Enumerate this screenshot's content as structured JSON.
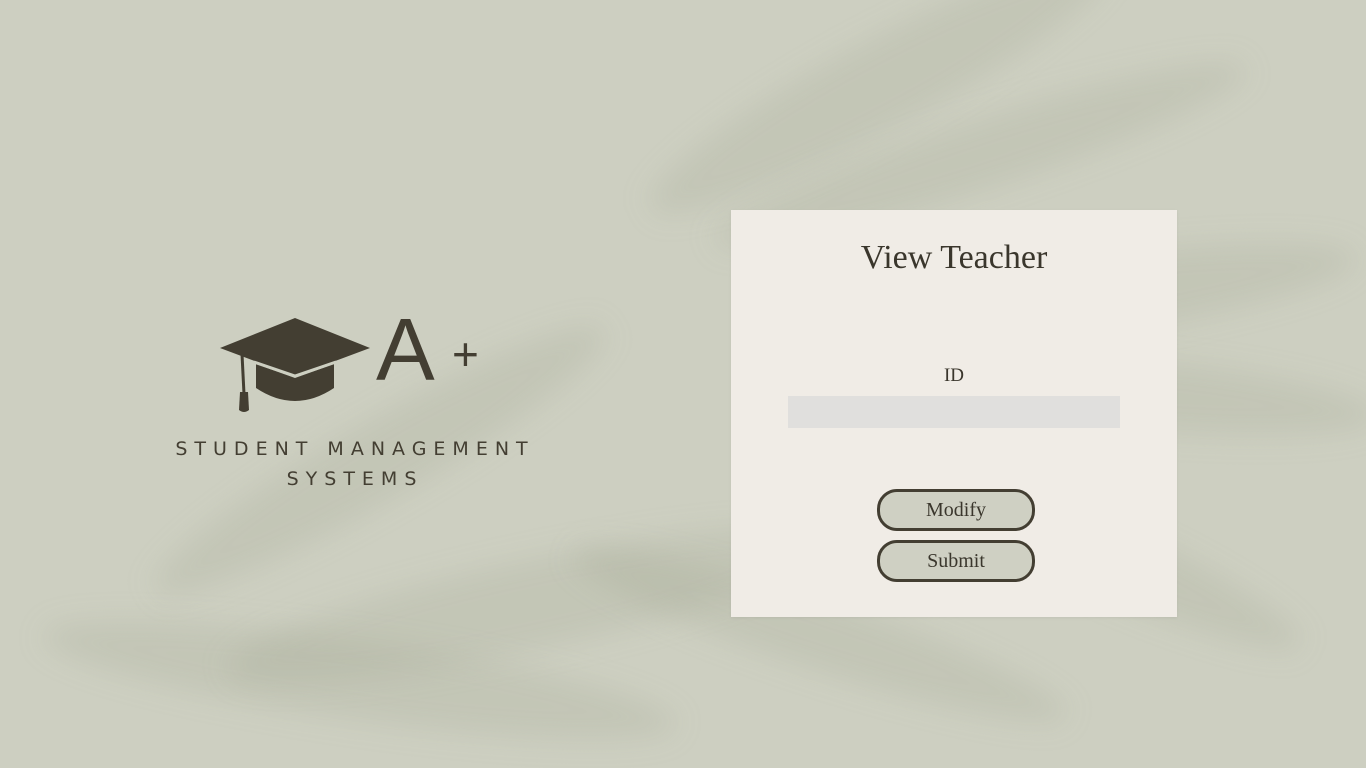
{
  "logo": {
    "mark": "A",
    "plus": "+",
    "tagline_line1": "STUDENT MANAGEMENT",
    "tagline_line2": "SYSTEMS",
    "icon": "graduation-cap-icon"
  },
  "form": {
    "title": "View Teacher",
    "id_label": "ID",
    "id_value": "",
    "modify_label": "Modify",
    "submit_label": "Submit"
  },
  "colors": {
    "background": "#cdcfc1",
    "card": "#f0ece6",
    "text_dark": "#433e32",
    "input": "#e0dfdd",
    "button_fill": "#cfd0c3"
  }
}
